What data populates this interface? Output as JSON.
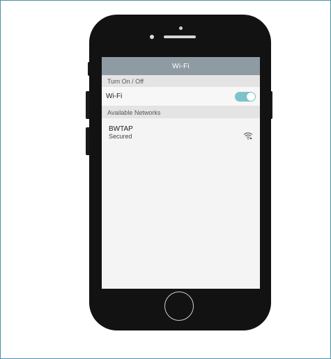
{
  "screen": {
    "title": "Wi-Fi",
    "section_power": "Turn On / Off",
    "wifi_row_label": "Wi-Fi",
    "wifi_enabled": true,
    "section_networks": "Available Networks",
    "networks": [
      {
        "name": "BWTAP",
        "status": "Secured",
        "icon": "wifi-signal-icon"
      }
    ]
  },
  "colors": {
    "titlebar": "#8f9ba2",
    "toggle_on": "#7dc4c8",
    "phone_body": "#121212"
  }
}
